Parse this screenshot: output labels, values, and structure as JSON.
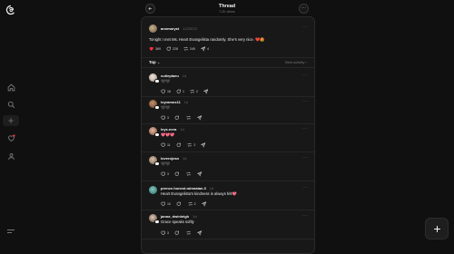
{
  "header": {
    "title": "Thread",
    "views": "7.2K views"
  },
  "post": {
    "username": "annmaryst",
    "date": "12/23/23",
    "text": "Tonight I met Ms. Heart Evangelista randomly. She's very nice. ❤️😍",
    "likes": "369",
    "replies": "228",
    "reposts": "249",
    "shares": "4"
  },
  "sort": {
    "label": "Top",
    "view_activity": "View activity"
  },
  "replies": [
    {
      "username": "cutiepiaeu",
      "age": "1d",
      "text": "🖤🖤",
      "likes": "16",
      "replies": "1",
      "reposts": "2"
    },
    {
      "username": "ivyramos11",
      "age": "1d",
      "text": "🖤🖤",
      "likes": "3",
      "replies": "",
      "reposts": ""
    },
    {
      "username": "leys.nera",
      "age": "1d",
      "text": "💖💖💖",
      "likes": "11",
      "replies": "",
      "reposts": "2"
    },
    {
      "username": "loverojean",
      "age": "1d",
      "text": "🖤🖤",
      "likes": "3",
      "replies": "",
      "reposts": ""
    },
    {
      "username": "prence.honest.rahmatan.3",
      "age": "1d",
      "text": "Heart Evangelista's kindness is always felt💖",
      "likes": "10",
      "replies": "",
      "reposts": "2"
    },
    {
      "username": "janna_dwinleigh",
      "age": "1d",
      "text": "Grace speaks softly",
      "likes": "3",
      "replies": "",
      "reposts": ""
    }
  ],
  "icons": [
    "threads-logo-icon",
    "home-icon",
    "search-icon",
    "create-icon",
    "heart-icon",
    "profile-icon",
    "menu-icon",
    "back-icon",
    "more-icon",
    "heart-icon",
    "comment-icon",
    "repost-icon",
    "share-icon",
    "plus-icon"
  ],
  "colors": {
    "background": "#101010",
    "panel": "#181818",
    "like_red": "#ff3040"
  }
}
